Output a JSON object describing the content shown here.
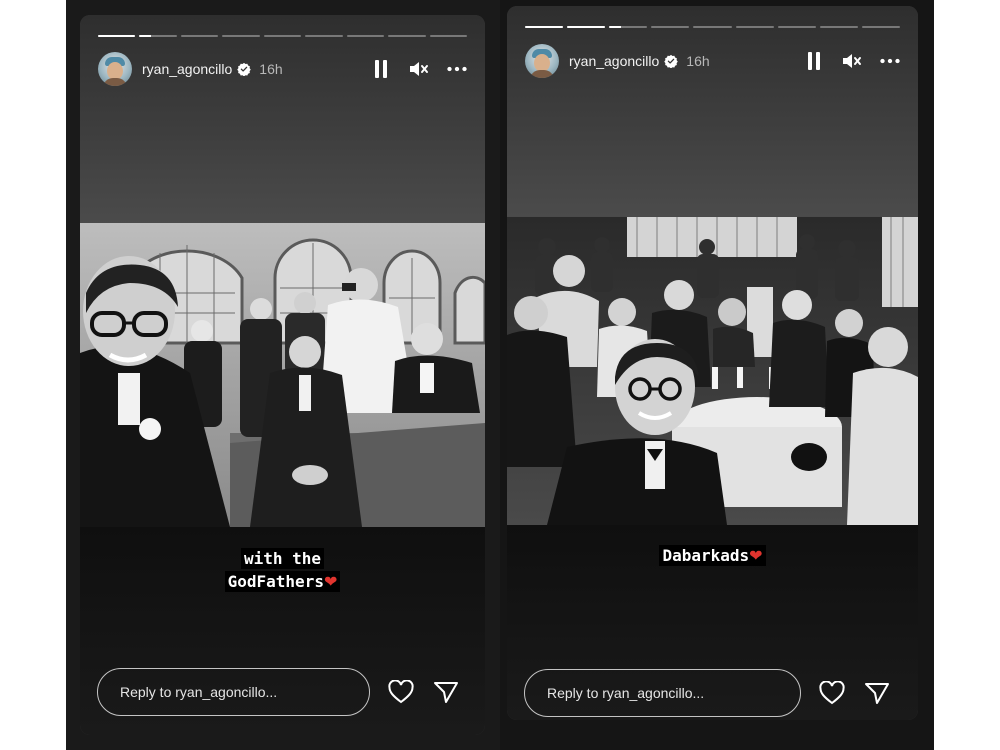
{
  "stories": [
    {
      "username": "ryan_agoncillo",
      "time": "16h",
      "progress": {
        "segments": 9,
        "active_segment": 2,
        "active_fill": 0.3
      },
      "caption_line1": "with the",
      "caption_line2": "GodFathers",
      "caption_emoji": "❤",
      "reply_placeholder": "Reply to ryan_agoncillo...",
      "icons": [
        "verified-icon",
        "pause-icon",
        "mute-icon",
        "more-icon",
        "heart-icon",
        "send-icon"
      ]
    },
    {
      "username": "ryan_agoncillo",
      "time": "16h",
      "progress": {
        "segments": 9,
        "active_segment": 3,
        "active_fill": 0.3
      },
      "caption_line1": "Dabarkads",
      "caption_emoji": "❤",
      "reply_placeholder": "Reply to ryan_agoncillo...",
      "icons": [
        "verified-icon",
        "pause-icon",
        "mute-icon",
        "more-icon",
        "heart-icon",
        "send-icon"
      ]
    }
  ],
  "colors": {
    "background": "#ffffff",
    "panel": "#1a1a1a",
    "heart": "#e0342e",
    "verified": "#ffffff"
  }
}
